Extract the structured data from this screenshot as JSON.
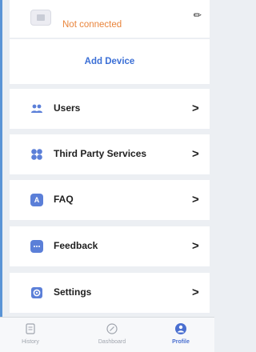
{
  "device": {
    "status": "Not connected"
  },
  "add_device": {
    "label": "Add Device"
  },
  "menu": [
    {
      "label": "Users",
      "icon": "users-icon"
    },
    {
      "label": "Third Party Services",
      "icon": "grid-icon"
    },
    {
      "label": "FAQ",
      "icon": "faq-icon"
    },
    {
      "label": "Feedback",
      "icon": "chat-icon"
    },
    {
      "label": "Settings",
      "icon": "gear-icon"
    }
  ],
  "tabs": [
    {
      "label": "History",
      "icon": "history-icon",
      "active": false
    },
    {
      "label": "Dashboard",
      "icon": "compass-icon",
      "active": false
    },
    {
      "label": "Profile",
      "icon": "profile-icon",
      "active": true
    }
  ],
  "colors": {
    "accent": "#3b6fd6",
    "status_warning": "#e9843b",
    "icon_blue": "#5b7fd8",
    "text_dark": "#1f1f1f",
    "tab_inactive": "#a0a5ae",
    "background": "#eceff3"
  }
}
